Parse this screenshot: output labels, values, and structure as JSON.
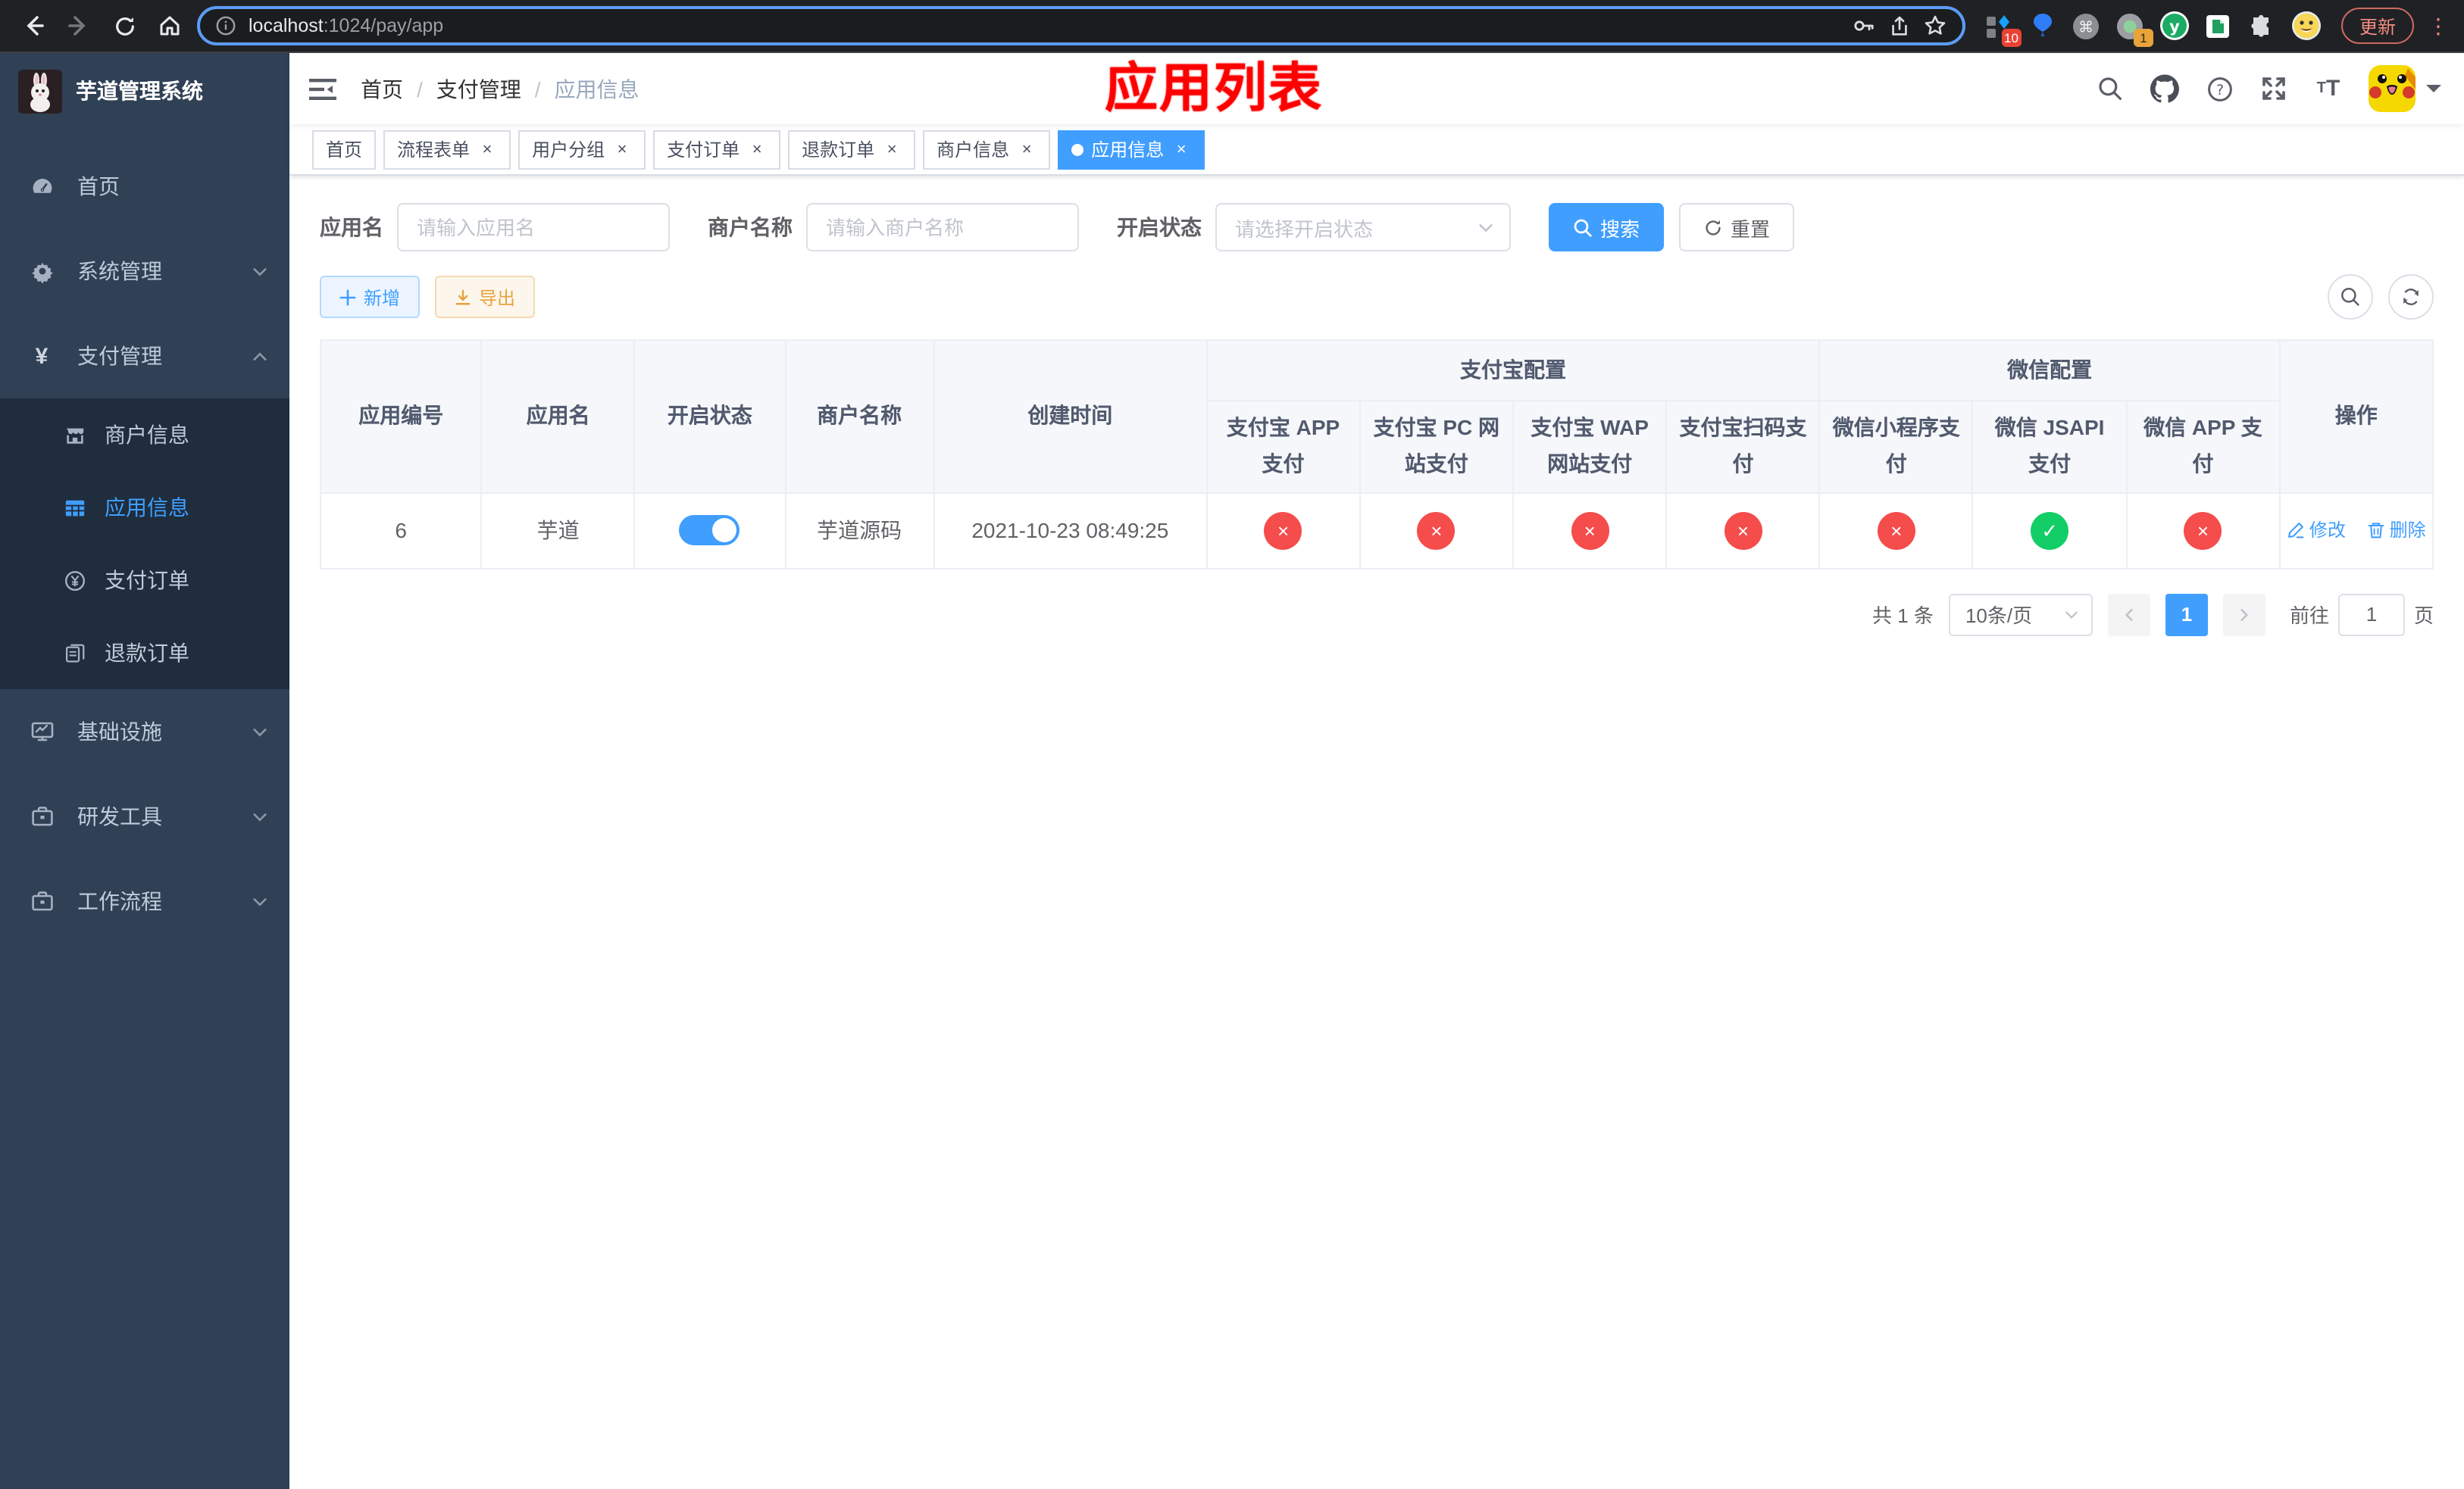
{
  "colors": {
    "accent": "#409eff",
    "status_on": "#13ce66",
    "status_off": "#f54c4c",
    "overlay_red": "#ff0000",
    "warning": "#e6a23c",
    "sidebar_bg": "#304156",
    "submenu_bg": "#1f2d3d"
  },
  "browser": {
    "url_host": "localhost",
    "url_path": ":1024/pay/app",
    "update_label": "更新",
    "ext_badge_blocks": "10",
    "ext_badge_record": "1"
  },
  "sidebar": {
    "title": "芋道管理系统",
    "items": {
      "home": {
        "label": "首页"
      },
      "system": {
        "label": "系统管理"
      },
      "pay": {
        "label": "支付管理"
      },
      "infra": {
        "label": "基础设施"
      },
      "devtool": {
        "label": "研发工具"
      },
      "workflow": {
        "label": "工作流程"
      }
    },
    "submenu": {
      "merchant": {
        "label": "商户信息"
      },
      "app": {
        "label": "应用信息"
      },
      "order": {
        "label": "支付订单"
      },
      "refund": {
        "label": "退款订单"
      }
    }
  },
  "header": {
    "breadcrumb": [
      "首页",
      "支付管理",
      "应用信息"
    ],
    "separator": "/",
    "overlay_title": "应用列表"
  },
  "tabs": {
    "close_glyph": "×",
    "items": [
      {
        "label": "首页",
        "closable": false,
        "active": false
      },
      {
        "label": "流程表单",
        "closable": true,
        "active": false
      },
      {
        "label": "用户分组",
        "closable": true,
        "active": false
      },
      {
        "label": "支付订单",
        "closable": true,
        "active": false
      },
      {
        "label": "退款订单",
        "closable": true,
        "active": false
      },
      {
        "label": "商户信息",
        "closable": true,
        "active": false
      },
      {
        "label": "应用信息",
        "closable": true,
        "active": true
      }
    ]
  },
  "filters": {
    "app_name_label": "应用名",
    "app_name_placeholder": "请输入应用名",
    "merchant_label": "商户名称",
    "merchant_placeholder": "请输入商户名称",
    "status_label": "开启状态",
    "status_placeholder": "请选择开启状态",
    "search_label": "搜索",
    "reset_label": "重置"
  },
  "toolbar": {
    "add_label": "新增",
    "export_label": "导出"
  },
  "table": {
    "group_alipay": "支付宝配置",
    "group_wechat": "微信配置",
    "col_id": "应用编号",
    "col_name": "应用名",
    "col_enabled": "开启状态",
    "col_merchant": "商户名称",
    "col_created": "创建时间",
    "col_op": "操作",
    "pay_columns": [
      "支付宝 APP 支付",
      "支付宝 PC 网站支付",
      "支付宝 WAP 网站支付",
      "支付宝扫码支付",
      "微信小程序支付",
      "微信 JSAPI 支付",
      "微信 APP 支付"
    ],
    "status_glyphs": {
      "ok": "✓",
      "fail": "×"
    },
    "row": {
      "id": "6",
      "app_name": "芋道",
      "enabled": true,
      "merchant_name": "芋道源码",
      "create_time": "2021-10-23 08:49:25",
      "pay_status": [
        false,
        false,
        false,
        false,
        false,
        true,
        false
      ],
      "edit_label": "修改",
      "delete_label": "删除"
    }
  },
  "pagination": {
    "total_text": "共 1 条",
    "page_size": "10条/页",
    "current_page": "1",
    "goto_label": "前往",
    "goto_value": "1",
    "page_unit": "页"
  }
}
